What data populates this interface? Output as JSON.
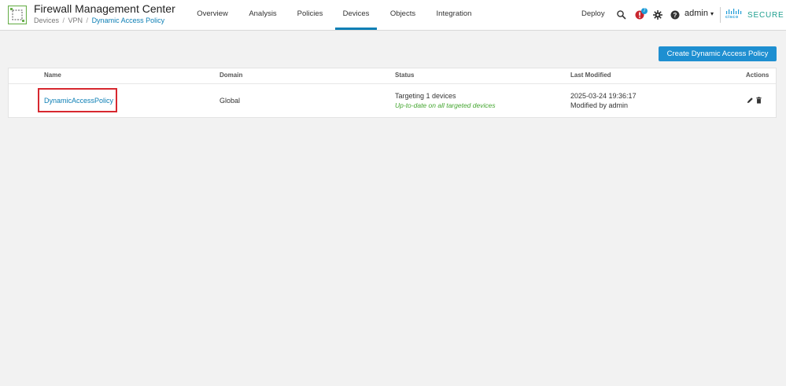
{
  "header": {
    "app_title": "Firewall Management Center",
    "breadcrumb": [
      "Devices",
      "VPN",
      "Dynamic Access Policy"
    ],
    "nav": [
      "Overview",
      "Analysis",
      "Policies",
      "Devices",
      "Objects",
      "Integration"
    ],
    "active_nav": "Devices",
    "deploy_label": "Deploy",
    "alert_count": "7",
    "user": "admin",
    "brand_small": "cisco",
    "brand_large": "SECURE",
    "icons": [
      "search-icon",
      "alert-icon",
      "gear-icon",
      "help-icon"
    ]
  },
  "toolbar": {
    "create_label": "Create Dynamic Access Policy"
  },
  "table": {
    "headers": {
      "name": "Name",
      "domain": "Domain",
      "status": "Status",
      "last_modified": "Last Modified",
      "actions": "Actions"
    },
    "rows": [
      {
        "name": "DynamicAccessPolicy",
        "domain": "Global",
        "status_line1": "Targeting 1 devices",
        "status_line2": "Up-to-date on all targeted devices",
        "modified_line1": "2025-03-24 19:36:17",
        "modified_line2": "Modified by admin"
      }
    ]
  },
  "colors": {
    "accent": "#0d7fb5",
    "button": "#1e8fd1",
    "status_ok": "#44a630",
    "highlight": "#d7282f"
  }
}
